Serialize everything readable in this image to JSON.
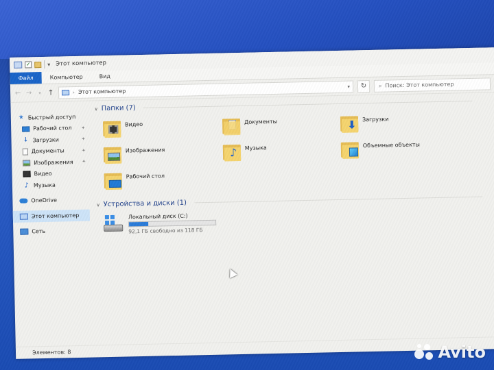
{
  "window": {
    "title": "Этот компьютер",
    "quick_access_dropdown": "▾"
  },
  "ribbon": {
    "tabs": [
      {
        "label": "Файл",
        "active": true
      },
      {
        "label": "Компьютер",
        "active": false
      },
      {
        "label": "Вид",
        "active": false
      }
    ]
  },
  "addressbar": {
    "path": "Этот компьютер",
    "search_placeholder": "Поиск: Этот компьютер"
  },
  "sidebar": {
    "quick_access": "Быстрый доступ",
    "items": [
      {
        "label": "Рабочий стол",
        "pinned": true
      },
      {
        "label": "Загрузки",
        "pinned": true
      },
      {
        "label": "Документы",
        "pinned": true
      },
      {
        "label": "Изображения",
        "pinned": true
      },
      {
        "label": "Видео",
        "pinned": false
      },
      {
        "label": "Музыка",
        "pinned": false
      }
    ],
    "onedrive": "OneDrive",
    "this_pc": "Этот компьютер",
    "network": "Сеть"
  },
  "folders_group": {
    "title": "Папки (7)",
    "items": [
      {
        "label": "Видео",
        "icon": "video-folder-icon"
      },
      {
        "label": "Документы",
        "icon": "documents-folder-icon"
      },
      {
        "label": "Загрузки",
        "icon": "downloads-folder-icon"
      },
      {
        "label": "Изображения",
        "icon": "pictures-folder-icon"
      },
      {
        "label": "Музыка",
        "icon": "music-folder-icon"
      },
      {
        "label": "Объемные объекты",
        "icon": "3d-objects-folder-icon"
      },
      {
        "label": "Рабочий стол",
        "icon": "desktop-folder-icon"
      }
    ]
  },
  "devices_group": {
    "title": "Устройства и диски (1)",
    "drive": {
      "label": "Локальный диск (C:)",
      "free_text": "92,1 ГБ свободно из 118 ГБ",
      "used_fraction": 0.22
    }
  },
  "statusbar": {
    "items_count": "Элементов: 8"
  },
  "watermark": {
    "text": "Avito"
  },
  "colors": {
    "accent": "#1964c8",
    "selection": "#cde3f8",
    "folder": "#f5d46e",
    "desktop_bg": "#2450c0"
  }
}
